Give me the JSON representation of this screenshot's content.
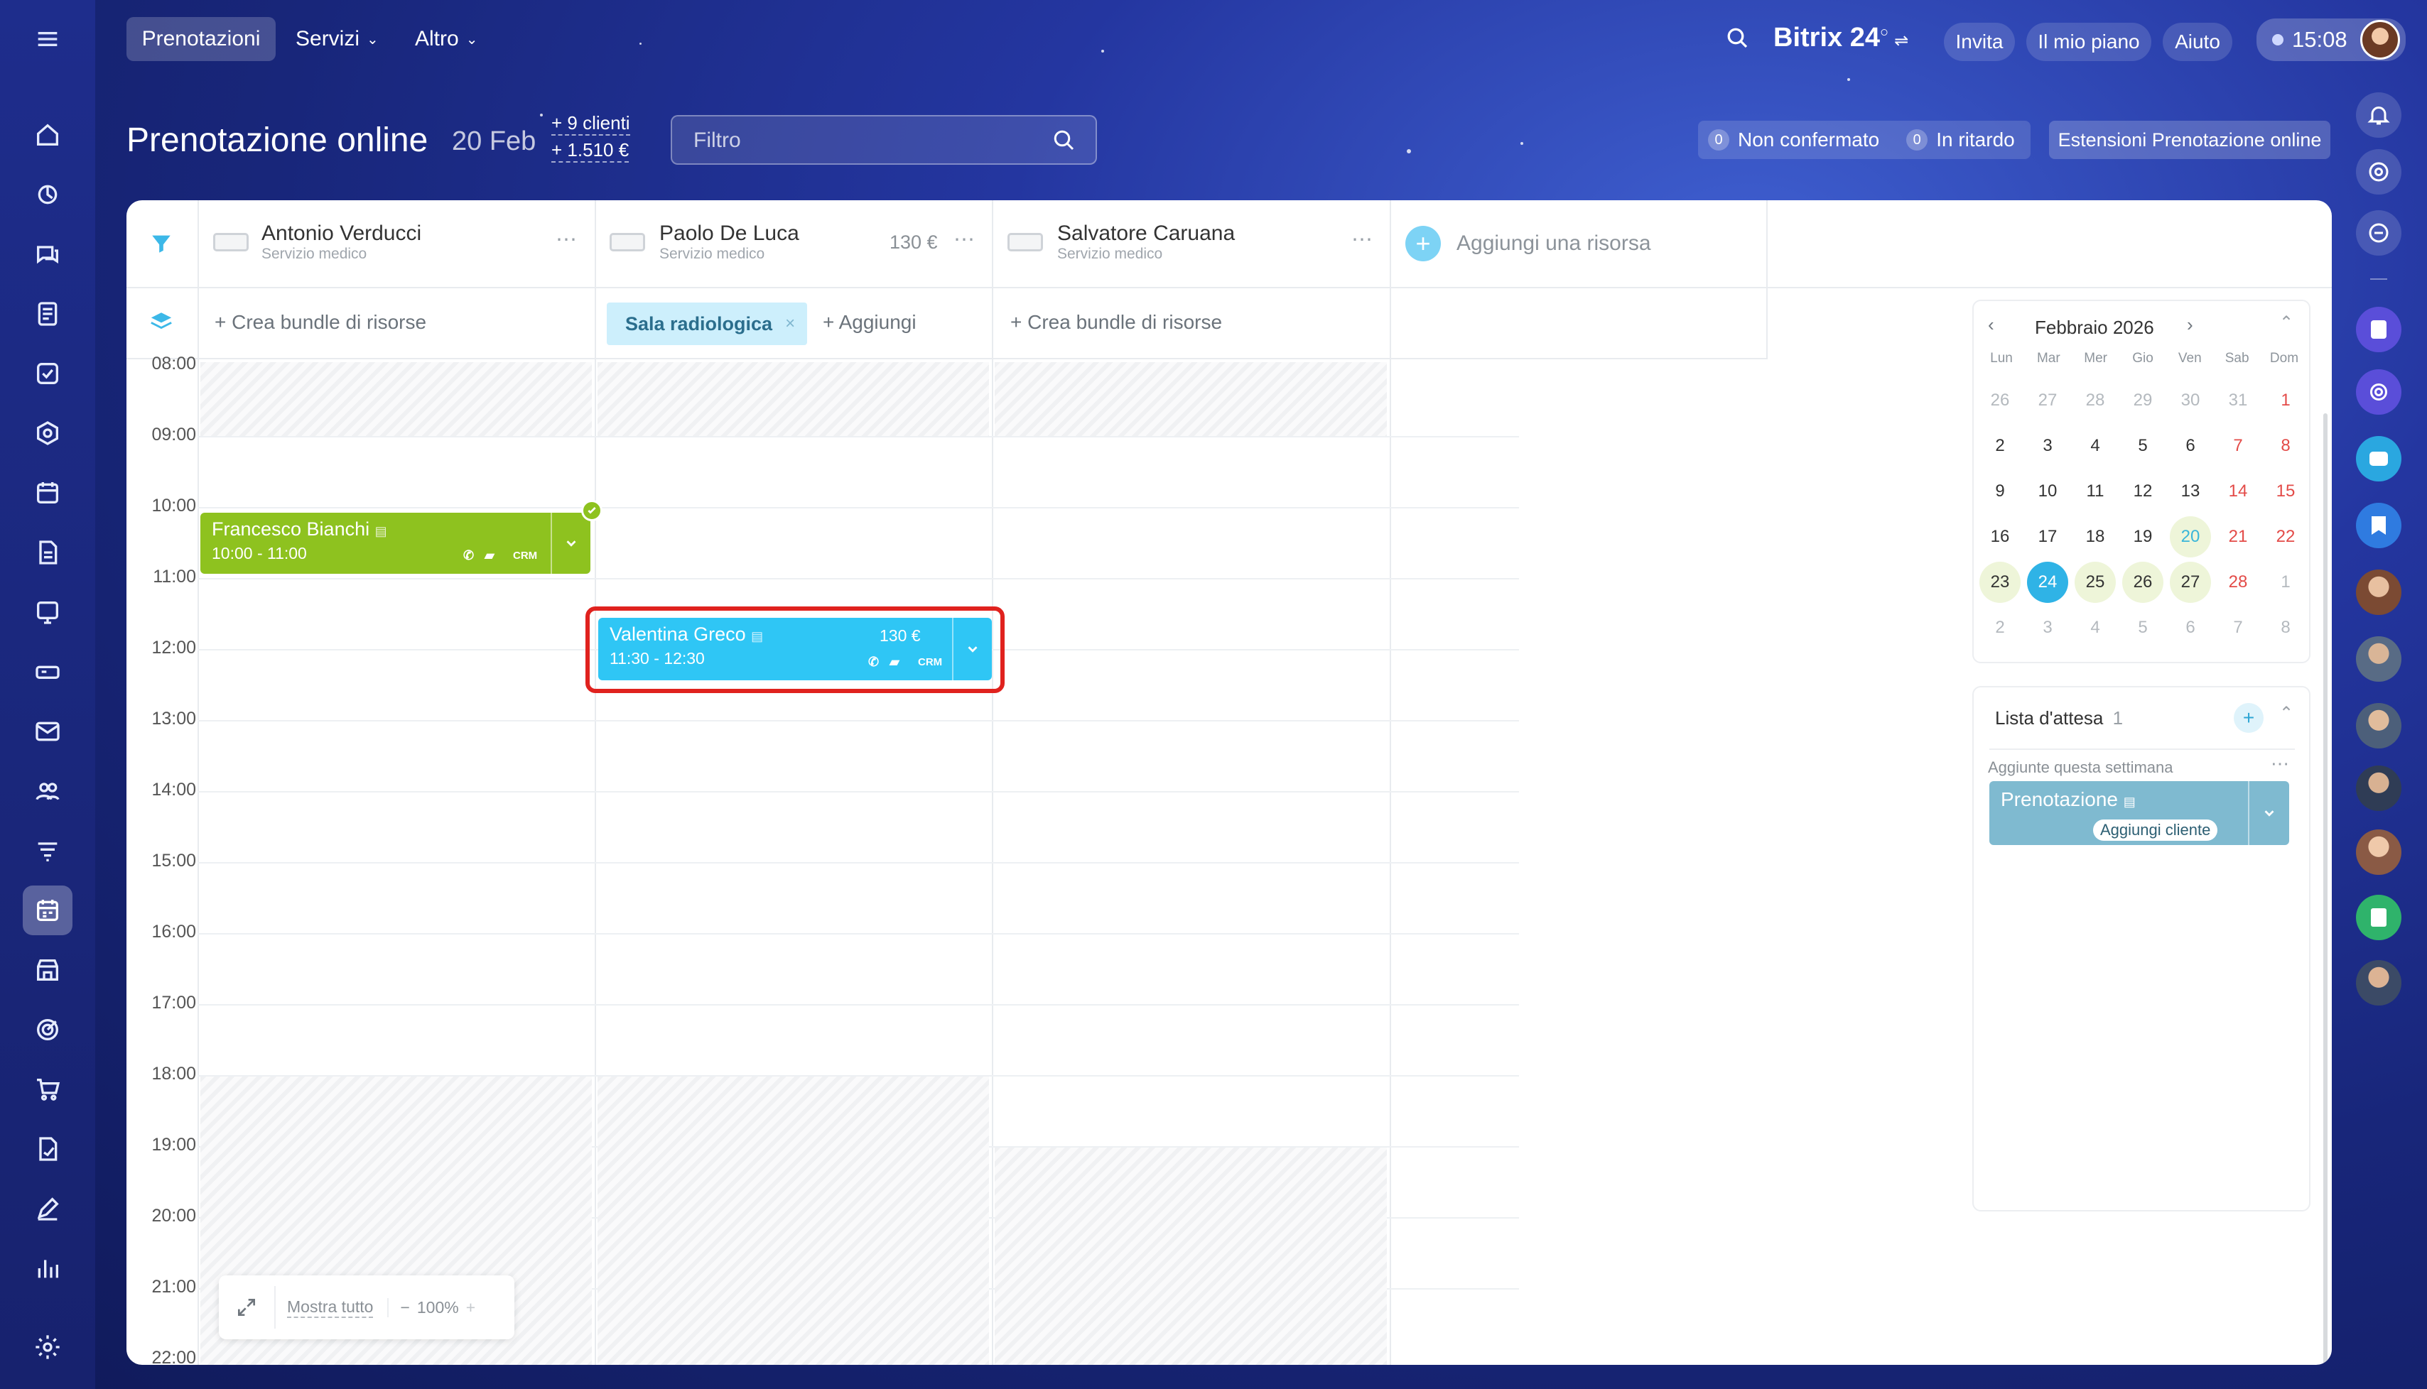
{
  "topbar": {
    "tabs": [
      {
        "label": "Prenotazioni"
      },
      {
        "label": "Servizi"
      },
      {
        "label": "Altro"
      }
    ],
    "brand": "Bitrix 24",
    "invite": "Invita",
    "plan": "Il mio piano",
    "help": "Aiuto",
    "time": "15:08"
  },
  "page": {
    "title": "Prenotazione online",
    "date": "20 Feb",
    "clients": "+ 9 clienti",
    "amount": "+ 1.510 €",
    "filter_placeholder": "Filtro",
    "unconfirmed_count": "0",
    "unconfirmed_label": "Non confermato",
    "late_count": "0",
    "late_label": "In ritardo",
    "extensions": "Estensioni Prenotazione online"
  },
  "resources": [
    {
      "name": "Antonio Verducci",
      "sub": "Servizio medico",
      "price": ""
    },
    {
      "name": "Paolo De Luca",
      "sub": "Servizio medico",
      "price": "130 €"
    },
    {
      "name": "Salvatore Caruana",
      "sub": "Servizio medico",
      "price": ""
    }
  ],
  "add_resource": "Aggiungi una risorsa",
  "bundles": {
    "create": "Crea bundle di risorse",
    "room": "Sala radiologica",
    "add": "Aggiungi"
  },
  "times": [
    "08:00",
    "09:00",
    "10:00",
    "11:00",
    "12:00",
    "13:00",
    "14:00",
    "15:00",
    "16:00",
    "17:00",
    "18:00",
    "19:00",
    "20:00",
    "21:00",
    "22:00"
  ],
  "bookings": [
    {
      "name": "Francesco Bianchi",
      "time": "10:00 - 11:00",
      "price": "",
      "color": "#8ec21f"
    },
    {
      "name": "Valentina Greco",
      "time": "11:30 - 12:30",
      "price": "130 €",
      "color": "#2fc6f5"
    }
  ],
  "zoom": {
    "show_all": "Mostra tutto",
    "level": "100%"
  },
  "calendar": {
    "month": "Febbraio 2026",
    "weekdays": [
      "Lun",
      "Mar",
      "Mer",
      "Gio",
      "Ven",
      "Sab",
      "Dom"
    ],
    "weeks": [
      [
        "26",
        "27",
        "28",
        "29",
        "30",
        "31",
        "1"
      ],
      [
        "2",
        "3",
        "4",
        "5",
        "6",
        "7",
        "8"
      ],
      [
        "9",
        "10",
        "11",
        "12",
        "13",
        "14",
        "15"
      ],
      [
        "16",
        "17",
        "18",
        "19",
        "20",
        "21",
        "22"
      ],
      [
        "23",
        "24",
        "25",
        "26",
        "27",
        "28",
        "1"
      ],
      [
        "2",
        "3",
        "4",
        "5",
        "6",
        "7",
        "8"
      ]
    ],
    "selected": "24",
    "today": "20"
  },
  "waitlist": {
    "title": "Lista d'attesa",
    "count": "1",
    "section": "Aggiunte questa settimana",
    "item": "Prenotazione",
    "add_client": "Aggiungi cliente"
  },
  "crm": "CRM"
}
